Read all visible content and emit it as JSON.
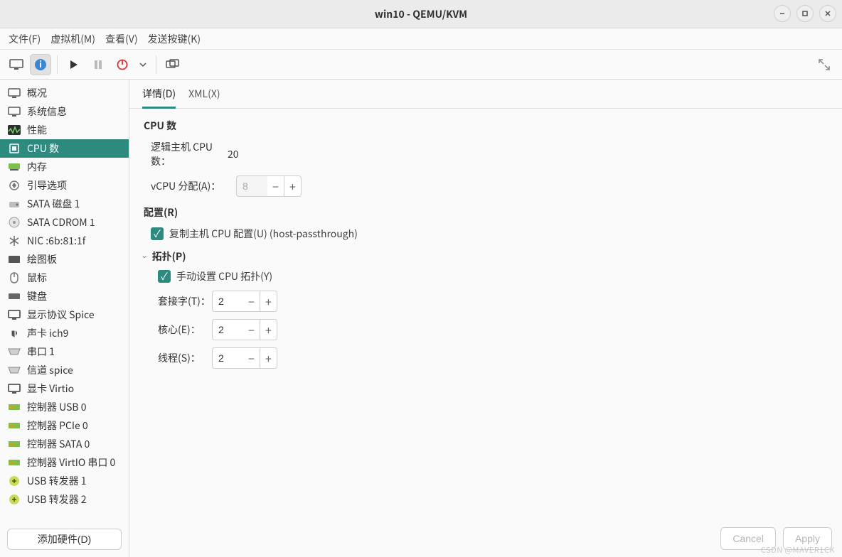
{
  "window": {
    "title": "win10 - QEMU/KVM"
  },
  "menubar": {
    "items": [
      "文件(F)",
      "虚拟机(M)",
      "查看(V)",
      "发送按键(K)"
    ]
  },
  "sidebar": {
    "add_hw_label": "添加硬件(D)",
    "items": [
      {
        "label": "概况",
        "icon": "monitor",
        "selected": false
      },
      {
        "label": "系统信息",
        "icon": "monitor",
        "selected": false
      },
      {
        "label": "性能",
        "icon": "perf",
        "selected": false
      },
      {
        "label": "CPU 数",
        "icon": "cpu",
        "selected": true
      },
      {
        "label": "内存",
        "icon": "memory",
        "selected": false
      },
      {
        "label": "引导选项",
        "icon": "boot",
        "selected": false
      },
      {
        "label": "SATA 磁盘 1",
        "icon": "disk",
        "selected": false
      },
      {
        "label": "SATA CDROM 1",
        "icon": "cdrom",
        "selected": false
      },
      {
        "label": "NIC :6b:81:1f",
        "icon": "nic",
        "selected": false
      },
      {
        "label": "绘图板",
        "icon": "tablet",
        "selected": false
      },
      {
        "label": "鼠标",
        "icon": "mouse",
        "selected": false
      },
      {
        "label": "键盘",
        "icon": "keyboard",
        "selected": false
      },
      {
        "label": "显示协议 Spice",
        "icon": "display",
        "selected": false
      },
      {
        "label": "声卡 ich9",
        "icon": "sound",
        "selected": false
      },
      {
        "label": "串口 1",
        "icon": "serial",
        "selected": false
      },
      {
        "label": "信道 spice",
        "icon": "serial",
        "selected": false
      },
      {
        "label": "显卡 Virtio",
        "icon": "display",
        "selected": false
      },
      {
        "label": "控制器 USB 0",
        "icon": "controller",
        "selected": false
      },
      {
        "label": "控制器 PCIe 0",
        "icon": "controller",
        "selected": false
      },
      {
        "label": "控制器 SATA 0",
        "icon": "controller",
        "selected": false
      },
      {
        "label": "控制器 VirtIO 串口 0",
        "icon": "controller",
        "selected": false
      },
      {
        "label": "USB 转发器 1",
        "icon": "usb-redir",
        "selected": false
      },
      {
        "label": "USB 转发器 2",
        "icon": "usb-redir",
        "selected": false
      }
    ]
  },
  "tabs": {
    "items": [
      {
        "label": "详情(D)",
        "active": true
      },
      {
        "label": "XML(X)",
        "active": false
      }
    ]
  },
  "cpu": {
    "section_title": "CPU 数",
    "logical_label": "逻辑主机 CPU 数：",
    "logical_value": "20",
    "vcpu_label": "vCPU 分配(A)：",
    "vcpu_value": "8",
    "config_title": "配置(R)",
    "copy_host_label": "复制主机 CPU 配置(U) (host-passthrough)",
    "copy_host_checked": true,
    "topology_title": "拓扑(P)",
    "manual_topology_label": "手动设置 CPU 拓扑(Y)",
    "manual_topology_checked": true,
    "sockets_label": "套接字(T)：",
    "sockets_value": "2",
    "cores_label": "核心(E)：",
    "cores_value": "2",
    "threads_label": "线程(S)：",
    "threads_value": "2"
  },
  "footer": {
    "cancel": "Cancel",
    "apply": "Apply"
  },
  "watermark": "CSDN @MAVER1CK"
}
